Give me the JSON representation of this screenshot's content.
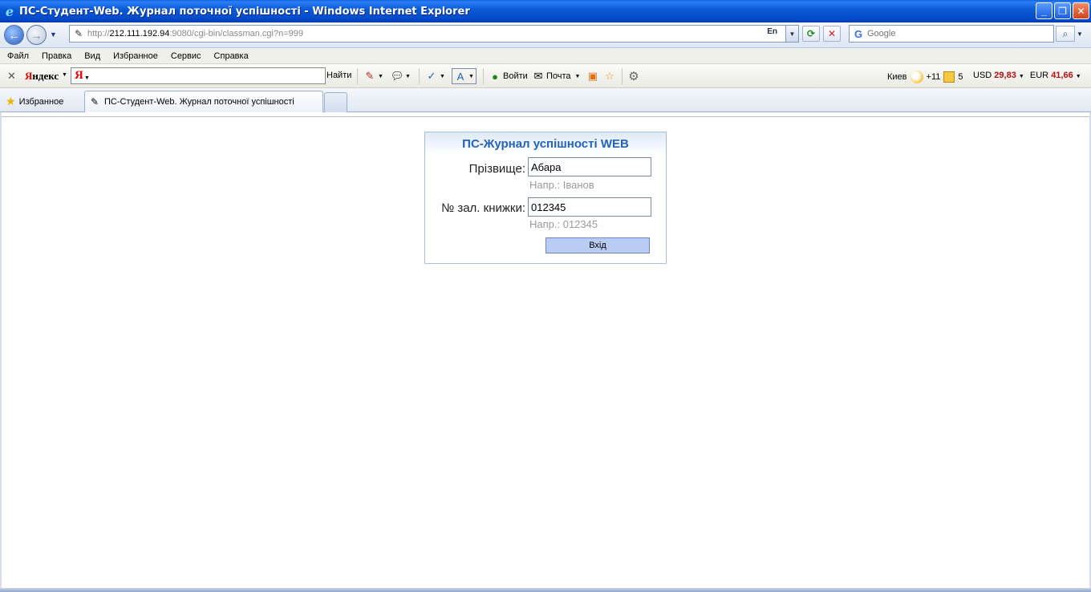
{
  "window": {
    "title": "ПС-Студент-Web. Журнал поточної успішності - Windows Internet Explorer"
  },
  "address_bar": {
    "url_prefix": "http://",
    "url_host": "212.111.192.94",
    "url_rest": ":9080/cgi-bin/classman.cgi?n=999",
    "lang": "En"
  },
  "search": {
    "placeholder": "Google"
  },
  "menu": [
    "Файл",
    "Правка",
    "Вид",
    "Избранное",
    "Сервис",
    "Справка"
  ],
  "yandex_toolbar": {
    "logo": "Яндекс",
    "find_label": "Найти",
    "login_label": "Войти",
    "mail_label": "Почта",
    "city": "Киев",
    "temperature": "+11",
    "mail_count": "5",
    "usd_label": "USD",
    "usd_value": "29,83",
    "eur_label": "EUR",
    "eur_value": "41,66"
  },
  "tabs": {
    "favorites_label": "Избранное",
    "active_tab": "ПС-Студент-Web. Журнал поточної успішності"
  },
  "login_form": {
    "heading": "ПС-Журнал успішності WEB",
    "surname_label": "Прізвище:",
    "surname_value": "Абара",
    "surname_hint": "Напр.: Іванов",
    "book_label": "№ зал. книжки:",
    "book_value": "012345",
    "book_hint": "Напр.: 012345",
    "submit_label": "Вхід"
  }
}
